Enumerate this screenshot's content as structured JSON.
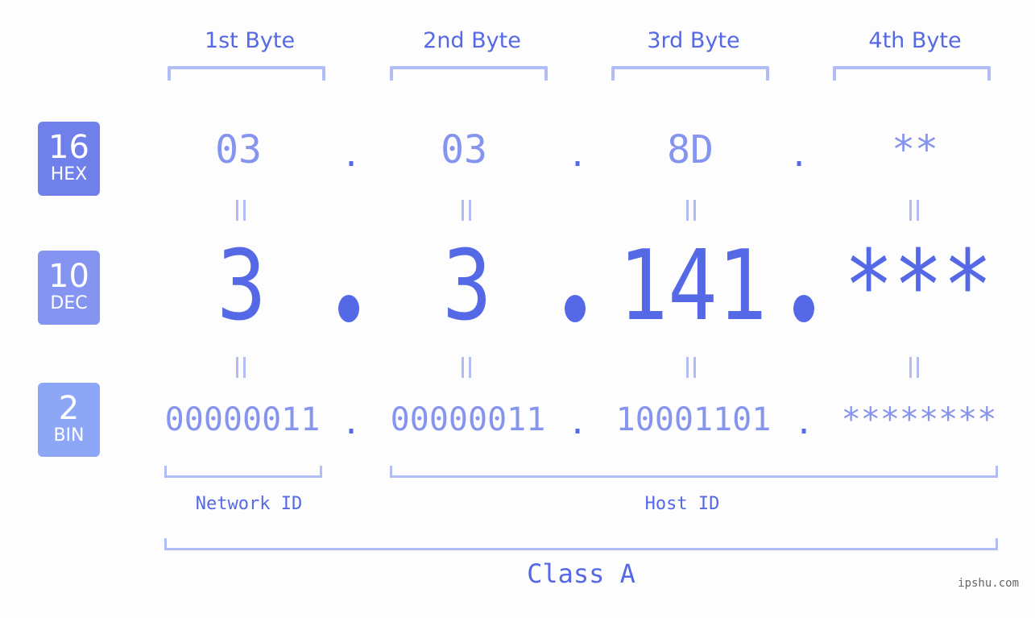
{
  "bytes": [
    {
      "label": "1st Byte",
      "hex": "03",
      "dec": "3",
      "bin": "00000011"
    },
    {
      "label": "2nd Byte",
      "hex": "03",
      "dec": "3",
      "bin": "00000011"
    },
    {
      "label": "3rd Byte",
      "hex": "8D",
      "dec": "141",
      "bin": "10001101"
    },
    {
      "label": "4th Byte",
      "hex": "**",
      "dec": "***",
      "bin": "********"
    }
  ],
  "separator": ".",
  "bases": {
    "hex": {
      "num": "16",
      "name": "HEX",
      "color": "#6f80ea"
    },
    "dec": {
      "num": "10",
      "name": "DEC",
      "color": "#8494f0"
    },
    "bin": {
      "num": "2",
      "name": "BIN",
      "color": "#8ea6f6"
    }
  },
  "segments": {
    "network": "Network ID",
    "host": "Host ID"
  },
  "class_label": "Class A",
  "watermark": "ipshu.com",
  "colors": {
    "accent": "#5569e6",
    "light": "#8594ee",
    "bracket": "#b2bdf6"
  }
}
